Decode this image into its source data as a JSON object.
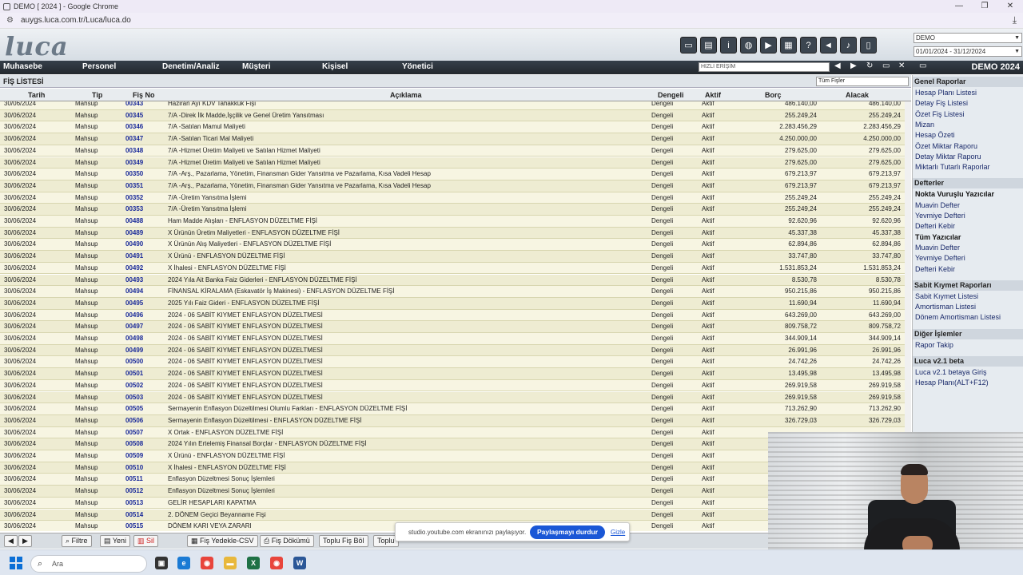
{
  "browser": {
    "title": "DEMO [ 2024 ] - Google Chrome",
    "url": "auygs.luca.com.tr/Luca/luca.do",
    "controls": [
      "—",
      "❐",
      "✕"
    ]
  },
  "app": {
    "logo": "luca",
    "company_select": "DEMO",
    "period_select": "01/01/2024 - 31/12/2024",
    "demo_label": "DEMO 2024",
    "toolbar_icons": [
      "calendar-icon",
      "book-icon",
      "info-icon",
      "globe-icon",
      "youtube-icon",
      "calculator-icon",
      "help-icon",
      "megaphone-icon",
      "bell-icon",
      "notebook-icon"
    ]
  },
  "nav": {
    "items": [
      "Muhasebe",
      "Personel",
      "Denetim/Analiz",
      "Müşteri",
      "Kişisel",
      "Yönetici"
    ],
    "quick_access": "HIZLI ERİŞİM"
  },
  "page": {
    "title": "FİŞ LİSTESİ",
    "filter_select": "Tüm Fişler"
  },
  "table": {
    "headers": {
      "date": "Tarih",
      "type": "Tip",
      "no": "Fiş No",
      "desc": "Açıklama",
      "balanced": "Dengeli",
      "active": "Aktif",
      "debit": "Borç",
      "credit": "Alacak"
    },
    "rows": [
      [
        "30/06/2024",
        "Mahsup",
        "00343",
        "Haziran Ayı KDV Tahakkuk Fişi",
        "Dengeli",
        "Aktif",
        "486.140,00",
        "486.140,00"
      ],
      [
        "30/06/2024",
        "Mahsup",
        "00345",
        "7/A -Direk İlk Madde,İşçilik ve Genel Üretim Yansıtması",
        "Dengeli",
        "Aktif",
        "255.249,24",
        "255.249,24"
      ],
      [
        "30/06/2024",
        "Mahsup",
        "00346",
        "7/A -Satılan Mamul Maliyeti",
        "Dengeli",
        "Aktif",
        "2.283.456,29",
        "2.283.456,29"
      ],
      [
        "30/06/2024",
        "Mahsup",
        "00347",
        "7/A -Satılan Ticari Mal Maliyeti",
        "Dengeli",
        "Aktif",
        "4.250.000,00",
        "4.250.000,00"
      ],
      [
        "30/06/2024",
        "Mahsup",
        "00348",
        "7/A -Hizmet Üretim Maliyeti ve Satılan Hizmet Maliyeti",
        "Dengeli",
        "Aktif",
        "279.625,00",
        "279.625,00"
      ],
      [
        "30/06/2024",
        "Mahsup",
        "00349",
        "7/A -Hizmet Üretim Maliyeti ve Satılan Hizmet Maliyeti",
        "Dengeli",
        "Aktif",
        "279.625,00",
        "279.625,00"
      ],
      [
        "30/06/2024",
        "Mahsup",
        "00350",
        "7/A -Arş., Pazarlama, Yönetim, Finansman Gider Yansıtma ve Pazarlama, Kısa Vadeli Hesap",
        "Dengeli",
        "Aktif",
        "679.213,97",
        "679.213,97"
      ],
      [
        "30/06/2024",
        "Mahsup",
        "00351",
        "7/A -Arş., Pazarlama, Yönetim, Finansman Gider Yansıtma ve Pazarlama, Kısa Vadeli Hesap",
        "Dengeli",
        "Aktif",
        "679.213,97",
        "679.213,97"
      ],
      [
        "30/06/2024",
        "Mahsup",
        "00352",
        "7/A -Üretim Yansıtma İşlemi",
        "Dengeli",
        "Aktif",
        "255.249,24",
        "255.249,24"
      ],
      [
        "30/06/2024",
        "Mahsup",
        "00353",
        "7/A -Üretim Yansıtma İşlemi",
        "Dengeli",
        "Aktif",
        "255.249,24",
        "255.249,24"
      ],
      [
        "30/06/2024",
        "Mahsup",
        "00488",
        "Ham Madde Alışları - ENFLASYON DÜZELTME FİŞİ",
        "Dengeli",
        "Aktif",
        "92.620,96",
        "92.620,96"
      ],
      [
        "30/06/2024",
        "Mahsup",
        "00489",
        "X Ürünün Üretim Maliyetleri - ENFLASYON DÜZELTME FİŞİ",
        "Dengeli",
        "Aktif",
        "45.337,38",
        "45.337,38"
      ],
      [
        "30/06/2024",
        "Mahsup",
        "00490",
        "X Ürünün Alış Maliyetleri - ENFLASYON DÜZELTME FİŞİ",
        "Dengeli",
        "Aktif",
        "62.894,86",
        "62.894,86"
      ],
      [
        "30/06/2024",
        "Mahsup",
        "00491",
        "X Ürünü - ENFLASYON DÜZELTME FİŞİ",
        "Dengeli",
        "Aktif",
        "33.747,80",
        "33.747,80"
      ],
      [
        "30/06/2024",
        "Mahsup",
        "00492",
        "X İhalesi - ENFLASYON DÜZELTME FİŞİ",
        "Dengeli",
        "Aktif",
        "1.531.853,24",
        "1.531.853,24"
      ],
      [
        "30/06/2024",
        "Mahsup",
        "00493",
        "2024 Yıla Ait Banka Faiz Giderleri - ENFLASYON DÜZELTME FİŞİ",
        "Dengeli",
        "Aktif",
        "8.530,78",
        "8.530,78"
      ],
      [
        "30/06/2024",
        "Mahsup",
        "00494",
        "FİNANSAL KİRALAMA (Eskavatör İş Makinesi) - ENFLASYON DÜZELTME FİŞİ",
        "Dengeli",
        "Aktif",
        "950.215,86",
        "950.215,86"
      ],
      [
        "30/06/2024",
        "Mahsup",
        "00495",
        "2025 Yılı Faiz Gideri - ENFLASYON DÜZELTME FİŞİ",
        "Dengeli",
        "Aktif",
        "11.690,94",
        "11.690,94"
      ],
      [
        "30/06/2024",
        "Mahsup",
        "00496",
        "2024 - 06 SABİT KIYMET ENFLASYON DÜZELTMESİ",
        "Dengeli",
        "Aktif",
        "643.269,00",
        "643.269,00"
      ],
      [
        "30/06/2024",
        "Mahsup",
        "00497",
        "2024 - 06 SABİT KIYMET ENFLASYON DÜZELTMESİ",
        "Dengeli",
        "Aktif",
        "809.758,72",
        "809.758,72"
      ],
      [
        "30/06/2024",
        "Mahsup",
        "00498",
        "2024 - 06 SABİT KIYMET ENFLASYON DÜZELTMESİ",
        "Dengeli",
        "Aktif",
        "344.909,14",
        "344.909,14"
      ],
      [
        "30/06/2024",
        "Mahsup",
        "00499",
        "2024 - 06 SABİT KIYMET ENFLASYON DÜZELTMESİ",
        "Dengeli",
        "Aktif",
        "26.991,96",
        "26.991,96"
      ],
      [
        "30/06/2024",
        "Mahsup",
        "00500",
        "2024 - 06 SABİT KIYMET ENFLASYON DÜZELTMESİ",
        "Dengeli",
        "Aktif",
        "24.742,26",
        "24.742,26"
      ],
      [
        "30/06/2024",
        "Mahsup",
        "00501",
        "2024 - 06 SABİT KIYMET ENFLASYON DÜZELTMESİ",
        "Dengeli",
        "Aktif",
        "13.495,98",
        "13.495,98"
      ],
      [
        "30/06/2024",
        "Mahsup",
        "00502",
        "2024 - 06 SABİT KIYMET ENFLASYON DÜZELTMESİ",
        "Dengeli",
        "Aktif",
        "269.919,58",
        "269.919,58"
      ],
      [
        "30/06/2024",
        "Mahsup",
        "00503",
        "2024 - 06 SABİT KIYMET ENFLASYON DÜZELTMESİ",
        "Dengeli",
        "Aktif",
        "269.919,58",
        "269.919,58"
      ],
      [
        "30/06/2024",
        "Mahsup",
        "00505",
        "Sermayenin Enflasyon Düzeltilmesi Olumlu Farkları - ENFLASYON DÜZELTME FİŞİ",
        "Dengeli",
        "Aktif",
        "713.262,90",
        "713.262,90"
      ],
      [
        "30/06/2024",
        "Mahsup",
        "00506",
        "Sermayenin Enflasyon Düzeltilmesi - ENFLASYON DÜZELTME FİŞİ",
        "Dengeli",
        "Aktif",
        "326.729,03",
        "326.729,03"
      ],
      [
        "30/06/2024",
        "Mahsup",
        "00507",
        "X Ortak - ENFLASYON DÜZELTME FİŞİ",
        "Dengeli",
        "Aktif",
        "",
        ""
      ],
      [
        "30/06/2024",
        "Mahsup",
        "00508",
        "2024 Yılın Ertelemiş Finansal Borçlar - ENFLASYON DÜZELTME FİŞİ",
        "Dengeli",
        "Aktif",
        "",
        ""
      ],
      [
        "30/06/2024",
        "Mahsup",
        "00509",
        "X Ürünü - ENFLASYON DÜZELTME FİŞİ",
        "Dengeli",
        "Aktif",
        "",
        ""
      ],
      [
        "30/06/2024",
        "Mahsup",
        "00510",
        "X İhalesi - ENFLASYON DÜZELTME FİŞİ",
        "Dengeli",
        "Aktif",
        "",
        ""
      ],
      [
        "30/06/2024",
        "Mahsup",
        "00511",
        "Enflasyon Düzeltmesi Sonuç İşlemleri",
        "Dengeli",
        "Aktif",
        "",
        ""
      ],
      [
        "30/06/2024",
        "Mahsup",
        "00512",
        "Enflasyon Düzeltmesi Sonuç İşlemleri",
        "Dengeli",
        "Aktif",
        "",
        ""
      ],
      [
        "30/06/2024",
        "Mahsup",
        "00513",
        "GELİR HESAPLARI KAPATMA",
        "Dengeli",
        "Aktif",
        "",
        ""
      ],
      [
        "30/06/2024",
        "Mahsup",
        "00514",
        "2. DÖNEM Geçici Beyanname Fişi",
        "Dengeli",
        "Aktif",
        "",
        ""
      ],
      [
        "30/06/2024",
        "Mahsup",
        "00515",
        "DÖNEM KARI VEYA ZARARI",
        "Dengeli",
        "Aktif",
        "",
        ""
      ]
    ]
  },
  "right_panel": {
    "sections": [
      {
        "title": "Genel Raporlar",
        "items": [
          "Hesap Planı Listesi",
          "Detay Fiş Listesi",
          "Özet Fiş Listesi",
          "Mizan",
          "Hesap Özeti",
          "Özet Miktar Raporu",
          "Detay Miktar Raporu",
          "Miktarlı Tutarlı Raporlar"
        ]
      },
      {
        "title": "Defterler",
        "items": [
          "Nokta Vuruşlu Yazıcılar",
          "Muavin Defter",
          "Yevmiye Defteri",
          "Defteri Kebir",
          "Tüm Yazıcılar",
          "Muavin Defter",
          "Yevmiye Defteri",
          "Defteri Kebir"
        ]
      },
      {
        "title": "Sabit Kıymet Raporları",
        "items": [
          "Sabit Kıymet Listesi",
          "Amortisman Listesi",
          "Dönem Amortisman Listesi"
        ]
      },
      {
        "title": "Diğer İşlemler",
        "items": [
          "Rapor Takip"
        ]
      },
      {
        "title": "Luca v2.1 beta",
        "items": [
          "Luca v2.1 betaya Giriş",
          "Hesap Planı(ALT+F12)"
        ]
      }
    ]
  },
  "bottom_buttons": [
    "◀",
    "▶",
    "Filtre",
    "Yeni",
    "Sil",
    "Fiş Yedekle-CSV",
    "Fiş Dökümü",
    "Toplu Fiş Böl",
    "Toplu"
  ],
  "share_bar": {
    "text": "studio.youtube.com ekranınızı paylaşıyor.",
    "stop": "Paylaşmayı durdur",
    "hide": "Gizle"
  },
  "taskbar": {
    "search_placeholder": "Ara"
  }
}
